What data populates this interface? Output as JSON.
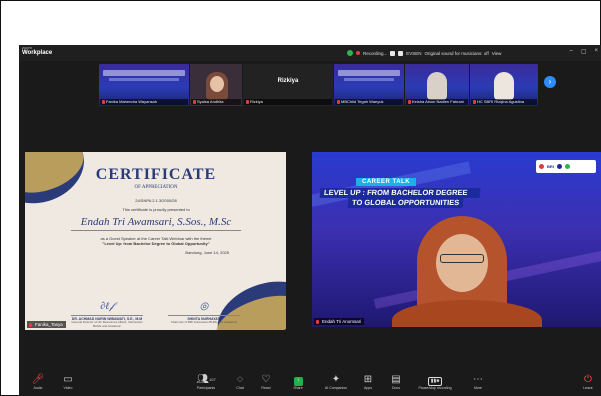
{
  "titlebar": {
    "brand_top": "zoom",
    "brand_bottom": "Workplace",
    "recording_label": "Recording...",
    "participant_chip": "EVSEN",
    "audio_status": "Original sound for musicians: off",
    "view_label": "View"
  },
  "strip": {
    "tiles": [
      {
        "name": "Fanika Mahendra Wayansah"
      },
      {
        "name": "Syalsa Andhita"
      },
      {
        "name": "Rizkiya",
        "label": "Rizkiya"
      },
      {
        "name": "MBChild Tegah Waeyuk"
      },
      {
        "name": "Keisha Ainun Nadien Fahrani"
      },
      {
        "name": "HC SBRI Rizqina Agustina"
      }
    ]
  },
  "certificate": {
    "title": "CERTIFICATE",
    "subtitle": "OF APPRECIATION",
    "number": "24/SNPA 2.1.3/2000/28",
    "presented": "This certificate is proudly presented to",
    "recipient": "Endah Tri Awamsari, S.Sos., M.Sc",
    "body_line1": "as a Guest Speaker at the Career Talk Webinar with the theme",
    "body_theme": "\"Level Up: from Bachelor Degree to Global Opportunity\"",
    "date": "Bandung, June 14, 2025",
    "signer1_name": "DR. ACHMAD NURIN WIBAWATI, S.E., M.M",
    "signer1_role": "General Director of HC Resources Affairs, Indonesian BUMs and Academic",
    "signer2_name": "SHINTA NURHAYATI",
    "signer2_role": "Chairman of BRI Indonesian BUMs and Academic",
    "speaker_name": "Fanika_Tasya"
  },
  "speaker": {
    "badge": "CAREER TALK",
    "headline1": "LEVEL UP : FROM BACHELOR DEGREE",
    "headline2": "TO GLOBAL OPPORTUNITIES",
    "logo": "BRI",
    "name": "Endah Tri Anomsari"
  },
  "toolbar": {
    "audio": "Audio",
    "video": "Video",
    "participants": "Participants",
    "participants_count": "107",
    "chat": "Chat",
    "react": "React",
    "share": "Share",
    "ai_companion": "AI Companion",
    "apps": "Apps",
    "docs": "Docs",
    "pause_stop": "Pause/stop recording",
    "more": "More",
    "leave": "Leave"
  },
  "colors": {
    "accent_blue": "#2d8cff",
    "recording_red": "#e23b3b",
    "share_green": "#22b14c"
  }
}
